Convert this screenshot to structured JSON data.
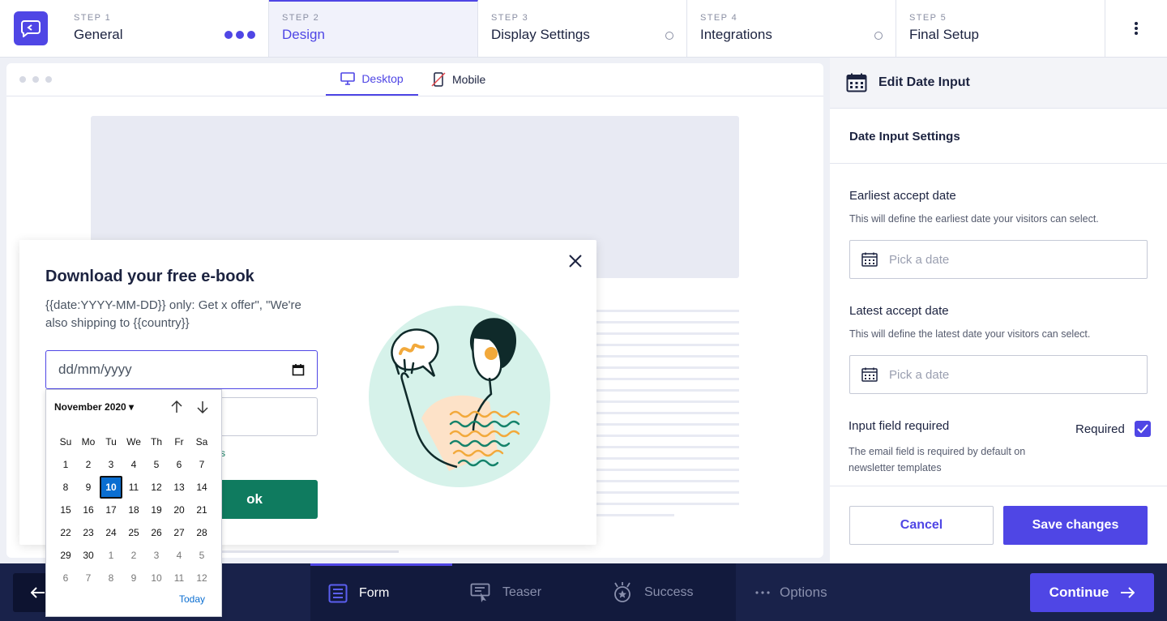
{
  "steps": [
    {
      "small": "STEP 1",
      "name": "General"
    },
    {
      "small": "STEP 2",
      "name": "Design"
    },
    {
      "small": "STEP 3",
      "name": "Display Settings"
    },
    {
      "small": "STEP 4",
      "name": "Integrations"
    },
    {
      "small": "STEP 5",
      "name": "Final Setup"
    }
  ],
  "preview": {
    "tab_desktop": "Desktop",
    "tab_mobile": "Mobile"
  },
  "popup": {
    "title": "Download your free e-book",
    "subtitle": "{{date:YYYY-MM-DD}} only: Get x offer\", \"We're also shipping to {{country}}",
    "date_placeholder": "dd/mm/yyyy",
    "partial_text": "s",
    "button_partial": "ok"
  },
  "calendar": {
    "month": "November 2020",
    "weekdays": [
      "Su",
      "Mo",
      "Tu",
      "We",
      "Th",
      "Fr",
      "Sa"
    ],
    "days": [
      "1",
      "2",
      "3",
      "4",
      "5",
      "6",
      "7",
      "8",
      "9",
      "10",
      "11",
      "12",
      "13",
      "14",
      "15",
      "16",
      "17",
      "18",
      "19",
      "20",
      "21",
      "22",
      "23",
      "24",
      "25",
      "26",
      "27",
      "28",
      "29",
      "30",
      "1",
      "2",
      "3",
      "4",
      "5",
      "6",
      "7",
      "8",
      "9",
      "10",
      "11",
      "12"
    ],
    "selected": "10",
    "today": "Today"
  },
  "panel": {
    "header": "Edit Date Input",
    "section": "Date Input Settings",
    "earliest_label": "Earliest accept date",
    "earliest_help": "This will define the earliest date your visitors can select.",
    "earliest_placeholder": "Pick a date",
    "latest_label": "Latest accept date",
    "latest_help": "This will define the latest date your visitors can select.",
    "latest_placeholder": "Pick a date",
    "required_label": "Input field required",
    "required_check": "Required",
    "required_checked": true,
    "required_help": "The email field is required by default on newsletter templates",
    "cancel": "Cancel",
    "save": "Save changes"
  },
  "bottom": {
    "tabs": [
      "Form",
      "Teaser",
      "Success"
    ],
    "options": "Options",
    "continue": "Continue"
  },
  "colors": {
    "accent": "#4f46e5",
    "green": "#0f7b5f",
    "navy": "#19224a"
  }
}
